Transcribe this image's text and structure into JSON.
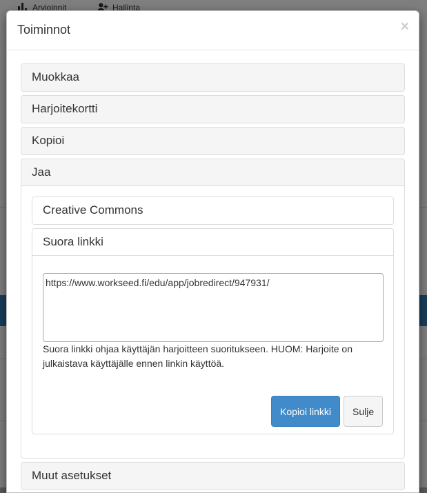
{
  "background": {
    "nav": [
      {
        "label": "Arvioinnit",
        "icon": "bar-chart-icon"
      },
      {
        "label": "Hallinta",
        "icon": "user-plus-icon"
      }
    ]
  },
  "modal": {
    "title": "Toiminnot",
    "close_symbol": "×",
    "sections": {
      "muokkaa": "Muokkaa",
      "harjoitekortti": "Harjoitekortti",
      "kopioi": "Kopioi",
      "jaa": "Jaa",
      "muut_asetukset": "Muut asetukset"
    },
    "jaa": {
      "creative_commons": "Creative Commons",
      "suora_linkki": {
        "title": "Suora linkki",
        "link_value": "https://www.workseed.fi/edu/app/jobredirect/947931/",
        "help_text": "Suora linkki ohjaa käyttäjän harjoitteen suoritukseen. HUOM: Harjoite on julkaistava käyttäjälle ennen linkin käyttöä.",
        "copy_button": "Kopioi linkki",
        "close_button": "Sulje"
      }
    }
  },
  "colors": {
    "primary": "#428bca",
    "overlay": "rgba(0,0,0,0.5)",
    "panel_heading_bg": "#f5f5f5"
  }
}
